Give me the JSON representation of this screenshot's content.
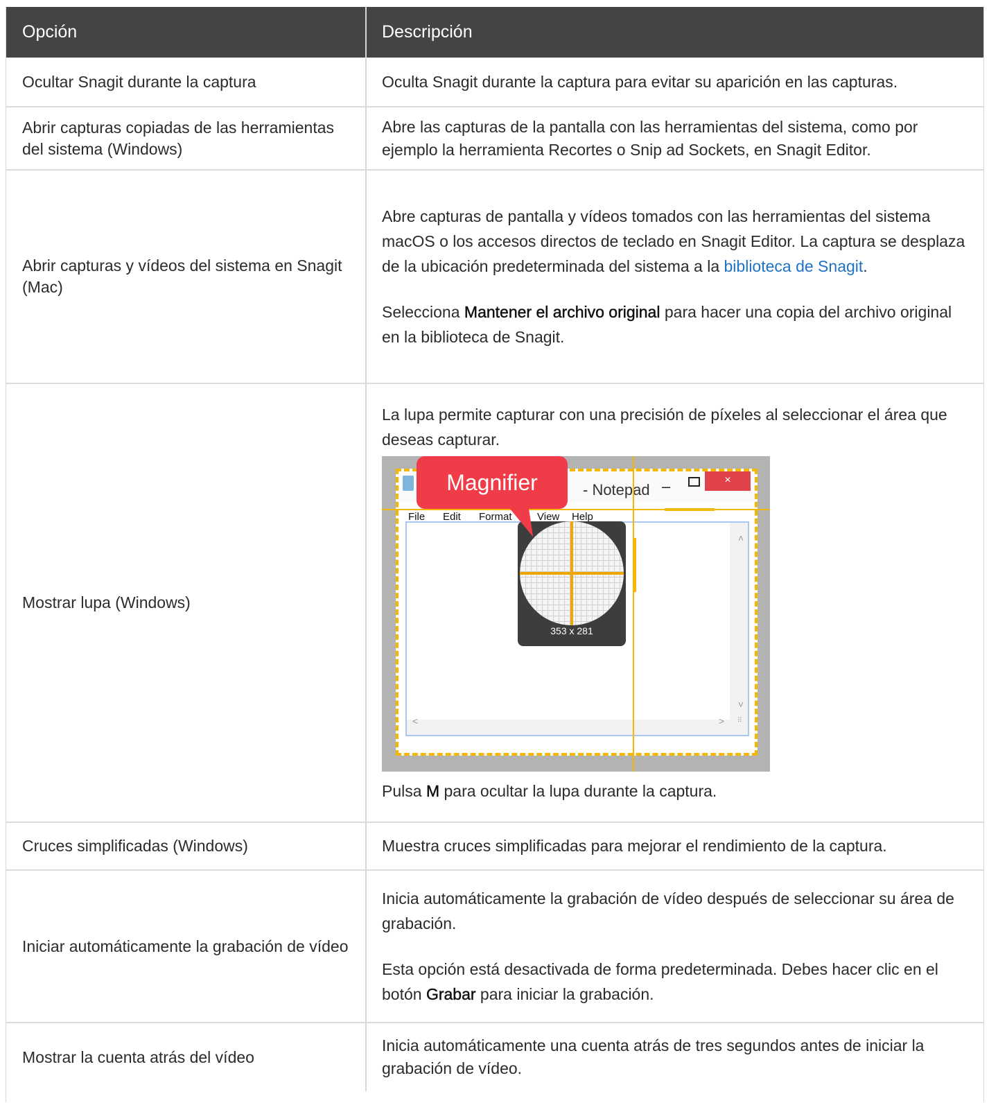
{
  "header": {
    "col_option": "Opción",
    "col_description": "Descripción"
  },
  "rows": [
    {
      "option": "Ocultar Snagit durante la captura",
      "description": "Oculta Snagit durante la captura para evitar su aparición en las capturas."
    },
    {
      "option": "Abrir capturas copiadas de las herramientas del sistema (Windows)",
      "description": "Abre las capturas de la pantalla con las herramientas del sistema, como por ejemplo la herramienta Recortes o Snip ad Sockets, en Snagit Editor."
    },
    {
      "option": "Abrir capturas y vídeos del sistema en Snagit (Mac)",
      "desc_p1_text": "Abre capturas de pantalla y vídeos tomados con las herramientas del sistema macOS o los accesos directos de teclado en Snagit Editor. La captura se desplaza de la ubicación predeterminada del sistema a la ",
      "desc_p1_link": "biblioteca de Snagit",
      "desc_p1_end": ".",
      "desc_p2_pre": "Selecciona ",
      "desc_p2_strong": "Mantener el archivo original",
      "desc_p2_post": " para hacer una copia del archivo original en la biblioteca de Snagit."
    },
    {
      "option": "Mostrar lupa (Windows)",
      "desc_p1": "La lupa permite capturar con una precisión de píxeles al seleccionar el área que deseas capturar.",
      "desc_p2_pre": "Pulsa ",
      "desc_p2_strong": "M",
      "desc_p2_post": " para ocultar la lupa durante la captura.",
      "image": {
        "callout": "Magnifier",
        "window_title": "- Notepad",
        "menu": [
          "File",
          "Edit",
          "Format",
          "View",
          "Help"
        ],
        "size_readout": "353 x 281",
        "close_glyph": "×",
        "min_glyph": "–"
      }
    },
    {
      "option": "Cruces simplificadas (Windows)",
      "description": "Muestra cruces simplificadas para mejorar el rendimiento de la captura."
    },
    {
      "option": "Iniciar automáticamente la grabación de vídeo",
      "desc_p1": "Inicia automáticamente la grabación de vídeo después de seleccionar su área de grabación.",
      "desc_p2_pre": "Esta opción está desactivada de forma predeterminada. Debes hacer clic en el botón ",
      "desc_p2_strong": "Grabar",
      "desc_p2_post": " para iniciar la grabación."
    },
    {
      "option": "Mostrar la cuenta atrás del vídeo",
      "description": "Inicia automáticamente una cuenta atrás de tres segundos antes de iniciar la grabación de vídeo."
    }
  ],
  "colors": {
    "header_bg": "#444444",
    "link": "#1f72c4",
    "highlight": "#f5b800",
    "callout": "#f03c48"
  }
}
